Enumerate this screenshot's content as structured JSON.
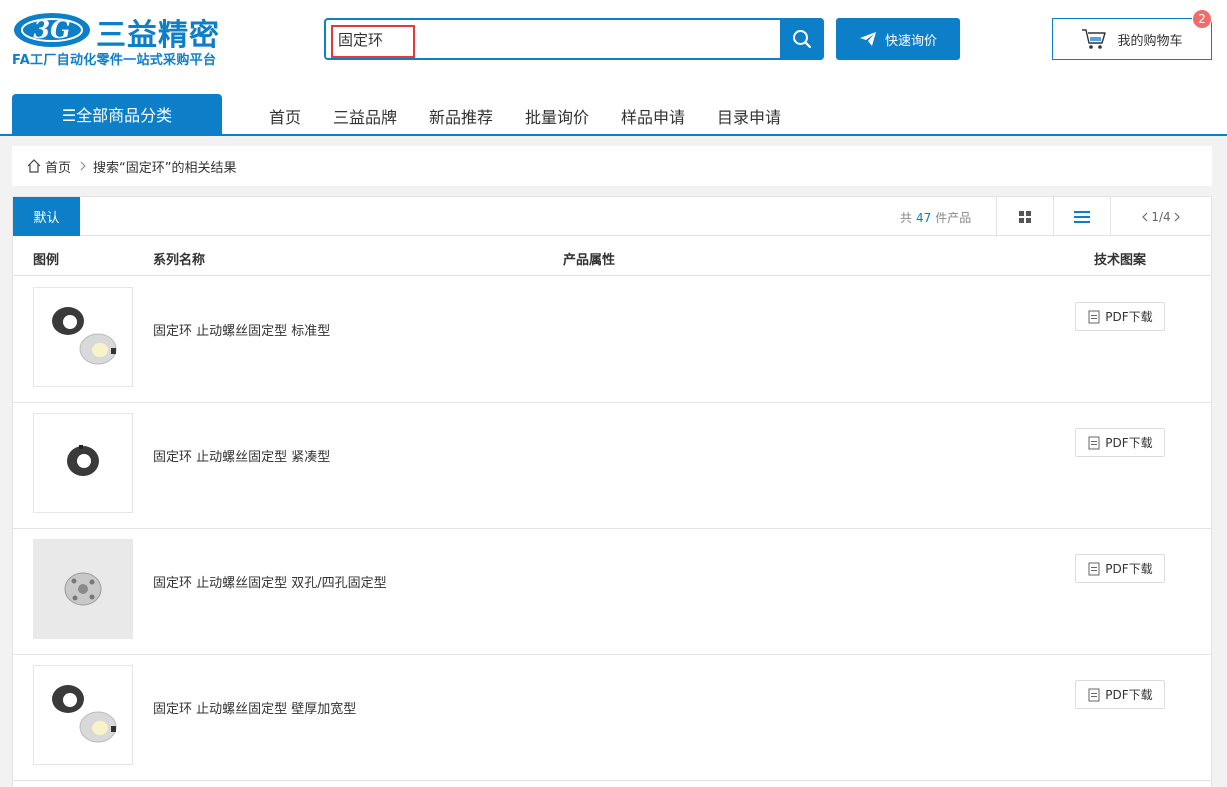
{
  "logo": {
    "mark": "3G",
    "name": "三益精密",
    "tagline": "FA工厂自动化零件一站式采购平台"
  },
  "search": {
    "value": "固定环",
    "placeholder": ""
  },
  "header": {
    "quote_label": "快速询价",
    "cart_label": "我的购物车",
    "cart_count": "2"
  },
  "nav": {
    "all_categories": "☰全部商品分类",
    "items": [
      "首页",
      "三益品牌",
      "新品推荐",
      "批量询价",
      "样品申请",
      "目录申请"
    ]
  },
  "breadcrumb": {
    "home": "首页",
    "current": "搜索“固定环”的相关结果"
  },
  "toolbar": {
    "default_tab": "默认",
    "count_prefix": "共",
    "count": "47",
    "count_suffix": "件产品",
    "page": "1/4"
  },
  "table": {
    "headers": [
      "图例",
      "系列名称",
      "产品属性",
      "技术图案"
    ],
    "rows": [
      {
        "name": "固定环 止动螺丝固定型 标准型",
        "pdf_label": "PDF下载"
      },
      {
        "name": "固定环 止动螺丝固定型 紧凑型",
        "pdf_label": "PDF下载"
      },
      {
        "name": "固定环 止动螺丝固定型 双孔/四孔固定型",
        "pdf_label": "PDF下载"
      },
      {
        "name": "固定环 止动螺丝固定型 壁厚加宽型",
        "pdf_label": "PDF下载"
      }
    ]
  },
  "colors": {
    "brand": "#0d7fc8",
    "highlight": "#e03a3a",
    "badge": "#f26b6b"
  }
}
